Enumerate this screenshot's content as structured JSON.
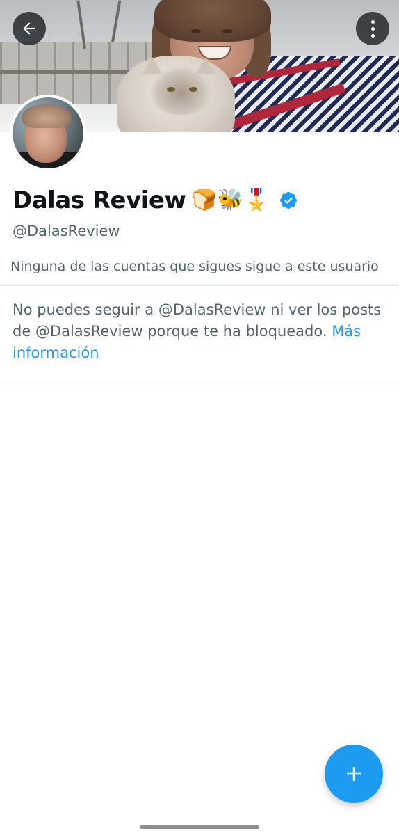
{
  "header": {
    "back_icon": "arrow-left-icon",
    "more_icon": "more-vertical-icon"
  },
  "profile": {
    "display_name": "Dalas Review",
    "name_emojis": "🍞🐝🎖️",
    "verified_icon": "verified-badge-icon",
    "verified_color": "#1d9bf0",
    "handle": "@DalasReview",
    "followers_note": "Ninguna de las cuentas que sigues sigue a este usuario"
  },
  "blocked": {
    "message": "No puedes seguir a @DalasReview ni ver los posts de @DalasReview porque te ha bloqueado.",
    "link_label": "Más información"
  },
  "fab": {
    "icon": "plus-icon",
    "color": "#1d9bf0"
  },
  "colors": {
    "primary_text": "#0f1419",
    "secondary_text": "#536471",
    "accent": "#1d9bf0",
    "divider": "#e1e6ea"
  }
}
